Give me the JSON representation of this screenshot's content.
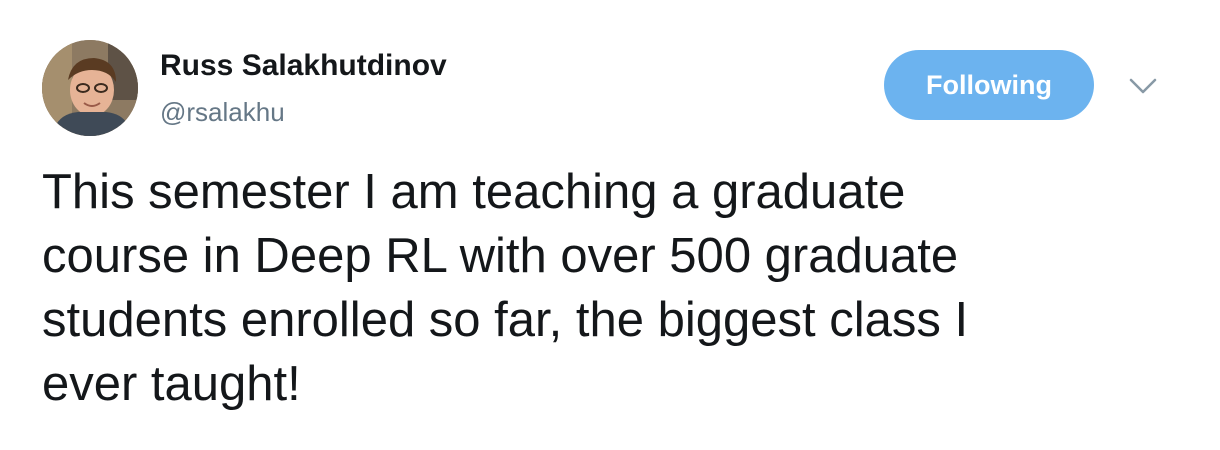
{
  "author": {
    "name": "Russ Salakhutdinov",
    "handle": "@rsalakhu",
    "avatar_icon": "profile-photo"
  },
  "actions": {
    "follow_label": "Following",
    "menu_icon": "chevron-down-icon"
  },
  "tweet": {
    "lines": [
      "This semester I am teaching a graduate",
      "course in Deep RL with over 500 graduate",
      "students enrolled so far, the biggest class I",
      "ever taught!"
    ]
  },
  "colors": {
    "button": "#6cb3ef",
    "handle": "#657786",
    "text": "#14171a"
  }
}
